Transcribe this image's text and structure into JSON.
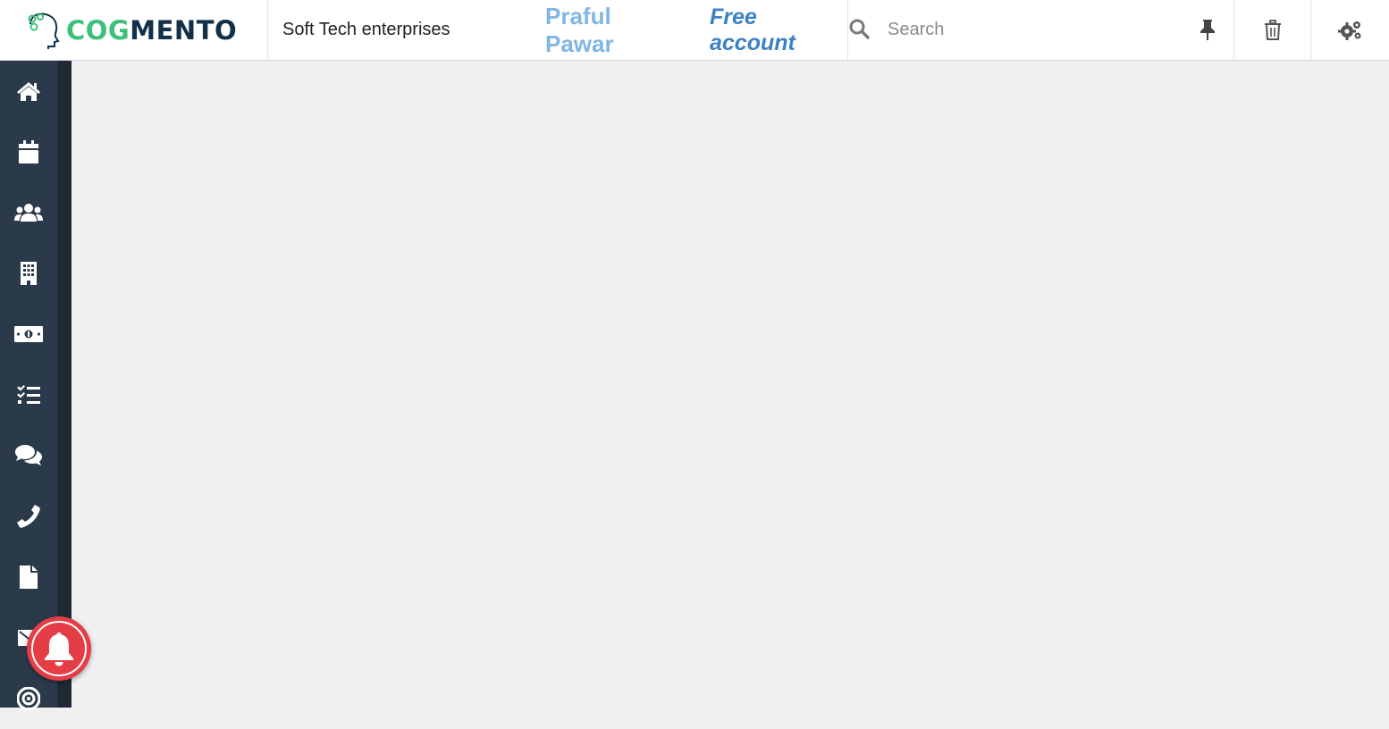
{
  "app": {
    "logo_part1": "COG",
    "logo_part2": "MENTO",
    "company_name": "Soft Tech enterprises",
    "user_name": "Praful Pawar",
    "account_type": "Free account"
  },
  "search": {
    "placeholder": "Search",
    "value": ""
  },
  "toolbar": {
    "icons": [
      "pin-icon",
      "trash-icon",
      "settings-icon"
    ]
  },
  "sidebar": {
    "items": [
      {
        "icon": "home-icon"
      },
      {
        "icon": "calendar-icon"
      },
      {
        "icon": "contacts-icon"
      },
      {
        "icon": "companies-icon"
      },
      {
        "icon": "deals-icon"
      },
      {
        "icon": "tasks-icon"
      },
      {
        "icon": "cases-icon"
      },
      {
        "icon": "calls-icon"
      },
      {
        "icon": "documents-icon"
      },
      {
        "icon": "email-icon"
      },
      {
        "icon": "campaigns-icon"
      }
    ]
  },
  "notifications": {
    "icon": "bell-icon"
  },
  "colors": {
    "sidebar_bg": "#2b3a4a",
    "logo_green": "#3ec07a",
    "logo_navy": "#12304a",
    "user_name": "#80b6e3",
    "account": "#3b82c4",
    "bell_bg": "#e53d45",
    "content_bg": "#f0f0f0"
  }
}
